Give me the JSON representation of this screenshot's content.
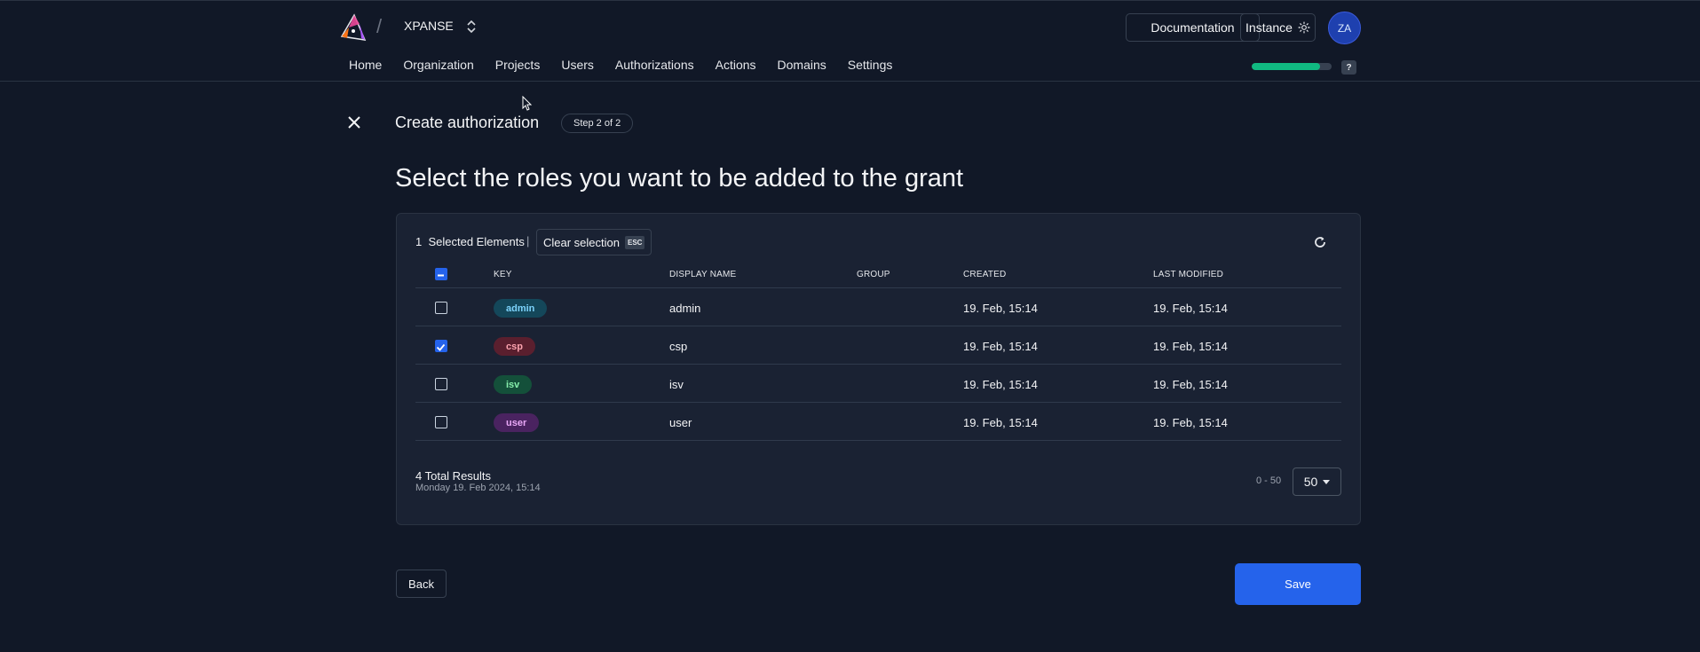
{
  "header": {
    "org_name": "XPANSE",
    "documentation_label": "Documentation",
    "instance_label": "Instance",
    "avatar_initials": "ZA",
    "help_label": "?",
    "progress": 0.85,
    "nav": [
      "Home",
      "Organization",
      "Projects",
      "Users",
      "Authorizations",
      "Actions",
      "Domains",
      "Settings"
    ]
  },
  "page": {
    "title": "Create authorization",
    "step": "Step 2 of 2",
    "heading": "Select the roles you want to be added to the grant"
  },
  "selection": {
    "count": "1",
    "label": "Selected Elements",
    "separator": "|",
    "clear_label": "Clear selection",
    "esc_key": "ESC"
  },
  "table": {
    "headers": {
      "key": "KEY",
      "display_name": "DISPLAY NAME",
      "group": "GROUP",
      "created": "CREATED",
      "last_modified": "LAST MODIFIED"
    },
    "rows": [
      {
        "key": "admin",
        "display_name": "admin",
        "group": "",
        "created": "19. Feb, 15:14",
        "last_modified": "19. Feb, 15:14",
        "checked": false,
        "chip_bg": "#14475a",
        "chip_fg": "#7dd3fc"
      },
      {
        "key": "csp",
        "display_name": "csp",
        "group": "",
        "created": "19. Feb, 15:14",
        "last_modified": "19. Feb, 15:14",
        "checked": true,
        "chip_bg": "#5a1f2e",
        "chip_fg": "#fda4af"
      },
      {
        "key": "isv",
        "display_name": "isv",
        "group": "",
        "created": "19. Feb, 15:14",
        "last_modified": "19. Feb, 15:14",
        "checked": false,
        "chip_bg": "#14503a",
        "chip_fg": "#86efac"
      },
      {
        "key": "user",
        "display_name": "user",
        "group": "",
        "created": "19. Feb, 15:14",
        "last_modified": "19. Feb, 15:14",
        "checked": false,
        "chip_bg": "#4a2360",
        "chip_fg": "#e9a8f7"
      }
    ]
  },
  "footer": {
    "total": "4 Total Results",
    "date": "Monday 19. Feb 2024, 15:14",
    "range": "0 - 50",
    "page_size": "50"
  },
  "actions": {
    "back": "Back",
    "save": "Save"
  },
  "colors": {
    "accent": "#2563eb",
    "progress": "#10b981",
    "background": "#111827"
  }
}
